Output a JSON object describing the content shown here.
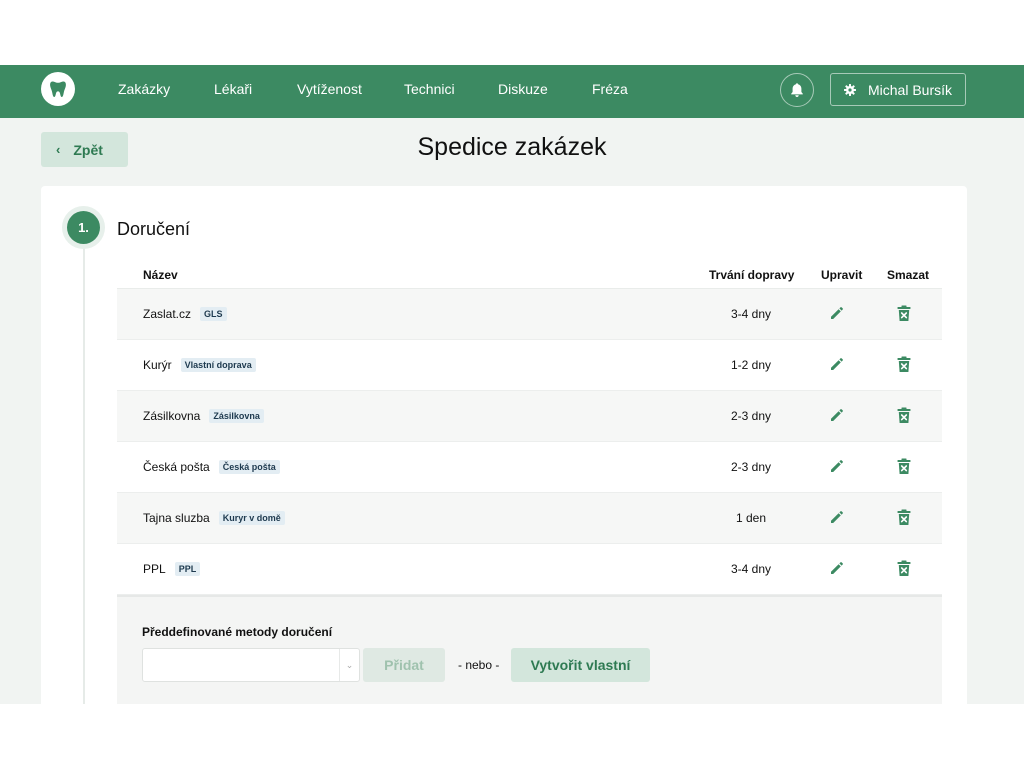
{
  "nav": {
    "items": [
      "Zakázky",
      "Lékaři",
      "Vytíženost",
      "Technici",
      "Diskuze",
      "Fréza"
    ],
    "user_name": "Michal Bursík"
  },
  "back_label": "Zpět",
  "page_title": "Spedice zakázek",
  "step": {
    "number": "1.",
    "title": "Doručení"
  },
  "table": {
    "headers": {
      "name": "Název",
      "duration": "Trvání dopravy",
      "edit": "Upravit",
      "delete": "Smazat"
    },
    "rows": [
      {
        "name": "Zaslat.cz",
        "tag": "GLS",
        "duration": "3-4 dny"
      },
      {
        "name": "Kurýr",
        "tag": "Vlastní doprava",
        "duration": "1-2 dny"
      },
      {
        "name": "Zásilkovna",
        "tag": "Zásilkovna",
        "duration": "2-3 dny"
      },
      {
        "name": "Česká pošta",
        "tag": "Česká pošta",
        "duration": "2-3 dny"
      },
      {
        "name": "Tajna sluzba",
        "tag": "Kuryr v domě",
        "duration": "1 den"
      },
      {
        "name": "PPL",
        "tag": "PPL",
        "duration": "3-4 dny"
      }
    ]
  },
  "predefined": {
    "label": "Předdefinované metody doručení",
    "select_value": "",
    "add_label": "Přidat",
    "or_label": "- nebo -",
    "create_label": "Vytvořit vlastní"
  },
  "colors": {
    "primary": "#3c8a62",
    "primary_light": "#d3e6dc",
    "background": "#f1f4f2"
  },
  "icons": {
    "logo": "tooth-icon",
    "notifications": "bell-icon",
    "settings": "gear-icon",
    "back": "chevron-left-icon",
    "edit": "pencil-icon",
    "delete": "trash-icon",
    "select": "chevron-down-icon"
  }
}
